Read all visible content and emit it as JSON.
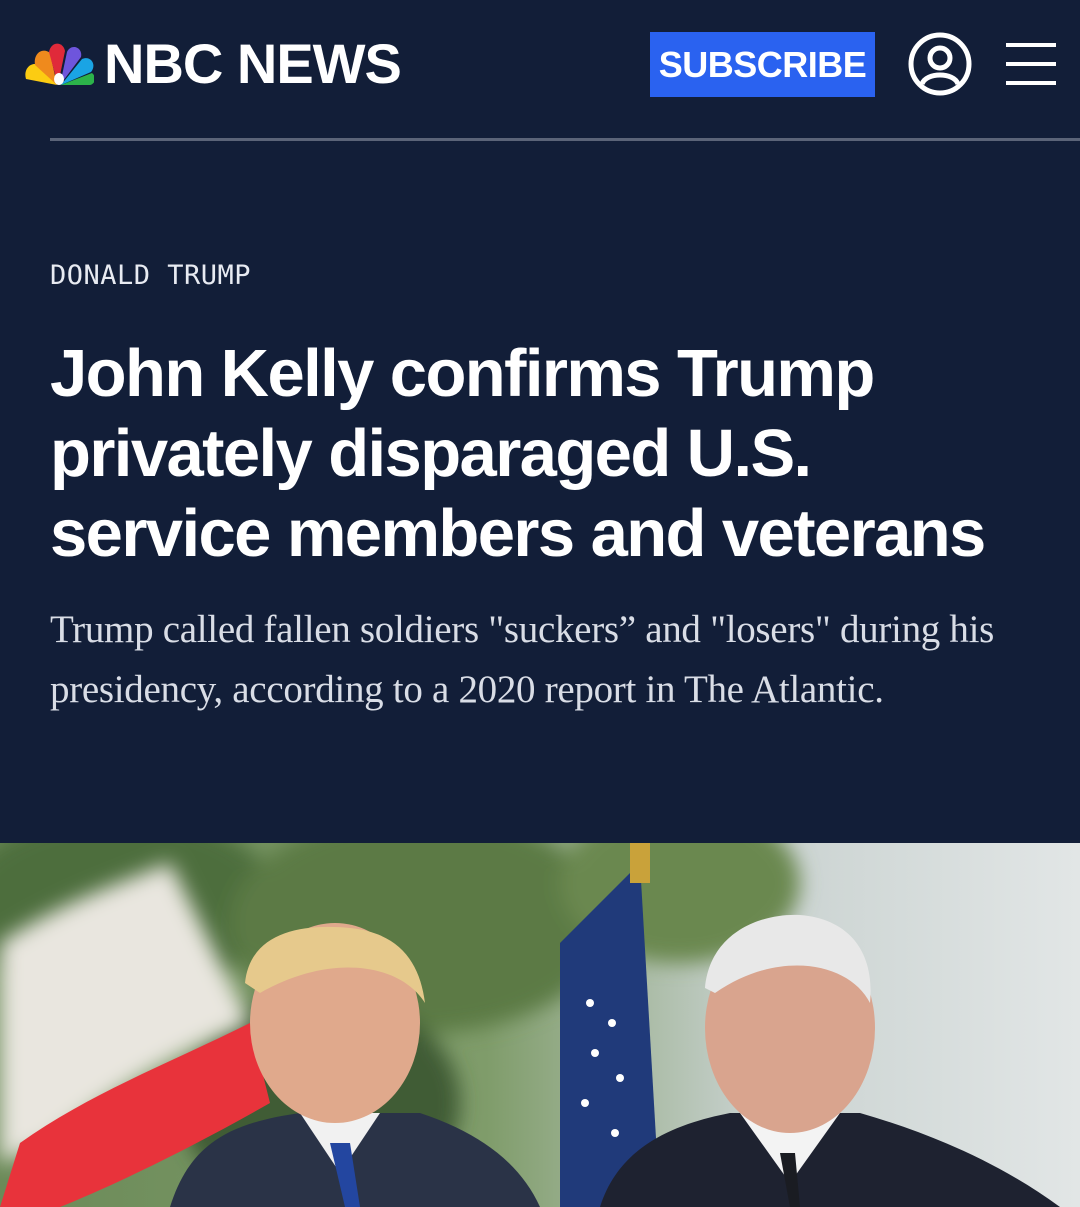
{
  "header": {
    "logo_text": "NBC NEWS",
    "subscribe_label": "SUBSCRIBE"
  },
  "article": {
    "kicker": "DONALD TRUMP",
    "headline": "John Kelly confirms Trump privately disparaged U.S. service members and veterans",
    "dek": "Trump called fallen soldiers \"suckers” and \"losers\" during his presidency, according to a 2020 report in The Atlantic."
  },
  "colors": {
    "background": "#121e38",
    "subscribe_button": "#2a62f0",
    "divider": "#5b6478"
  },
  "icons": [
    "nbc-peacock-logo",
    "account-icon",
    "hamburger-menu-icon"
  ]
}
